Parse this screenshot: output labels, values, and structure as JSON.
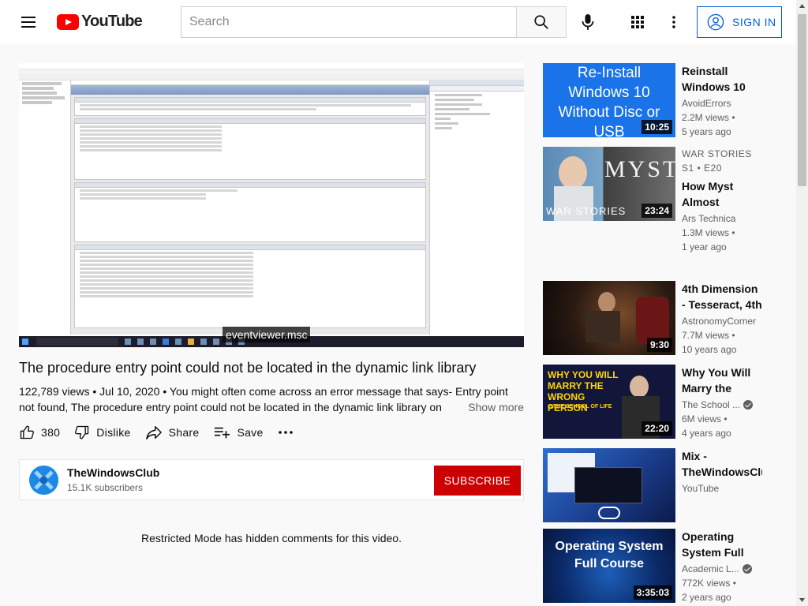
{
  "header": {
    "logo_text": "YouTube",
    "search_placeholder": "Search",
    "signin_label": "SIGN IN"
  },
  "player": {
    "caption": "eventviewer.msc"
  },
  "video": {
    "title": "The procedure entry point could not be located in the dynamic link library",
    "views_date": "122,789 views • Jul 10, 2020",
    "description": "You might often come across an error message that says- Entry point not found, The procedure entry point could not be located in the dynamic link library on",
    "show_more": "Show more",
    "likes": "380",
    "dislike_label": "Dislike",
    "share_label": "Share",
    "save_label": "Save"
  },
  "channel": {
    "name": "TheWindowsClub",
    "subscribers": "15.1K subscribers",
    "subscribe_label": "SUBSCRIBE"
  },
  "comments": {
    "restricted_text": "Restricted Mode has hidden comments for this video."
  },
  "recommendations": [
    {
      "title": "Reinstall Windows 10",
      "channel": "AvoidErrors",
      "views": "2.2M views •",
      "age": "5 years ago",
      "duration": "10:25",
      "thumb_text": "Re-Install Windows 10 Without Disc or USB",
      "verified": false
    },
    {
      "title": "WAR STORIES S1 • E20",
      "title2": "How Myst Almost Couldn't",
      "channel": "Ars Technica",
      "views": "1.3M views •",
      "age": "1 year ago",
      "duration": "23:24",
      "thumb_text": "MYST",
      "thumb_text2": "WAR STORIES",
      "verified": false
    },
    {
      "title": "4th Dimension - Tesseract, 4th",
      "channel": "AstronomyCorner",
      "views": "7.7M views •",
      "age": "10 years ago",
      "duration": "9:30",
      "verified": false
    },
    {
      "title": "Why You Will Marry the",
      "channel": "The School ...",
      "views": "6M views •",
      "age": "4 years ago",
      "duration": "22:20",
      "thumb_text": "WHY YOU WILL MARRY THE WRONG PERSON",
      "thumb_text2": "@THE SCHOOL OF LIFE",
      "verified": true
    },
    {
      "title": "Mix - TheWindowsClub",
      "channel": "YouTube",
      "views": "",
      "age": "",
      "duration": "",
      "verified": false
    },
    {
      "title": "Operating System Full",
      "channel": "Academic L...",
      "views": "772K views •",
      "age": "2 years ago",
      "duration": "3:35:03",
      "thumb_text": "Operating System Full Course",
      "verified": true
    }
  ],
  "colors": {
    "brand_red": "#ff0000",
    "subscribe_red": "#cc0000",
    "link_blue": "#065fd4"
  }
}
